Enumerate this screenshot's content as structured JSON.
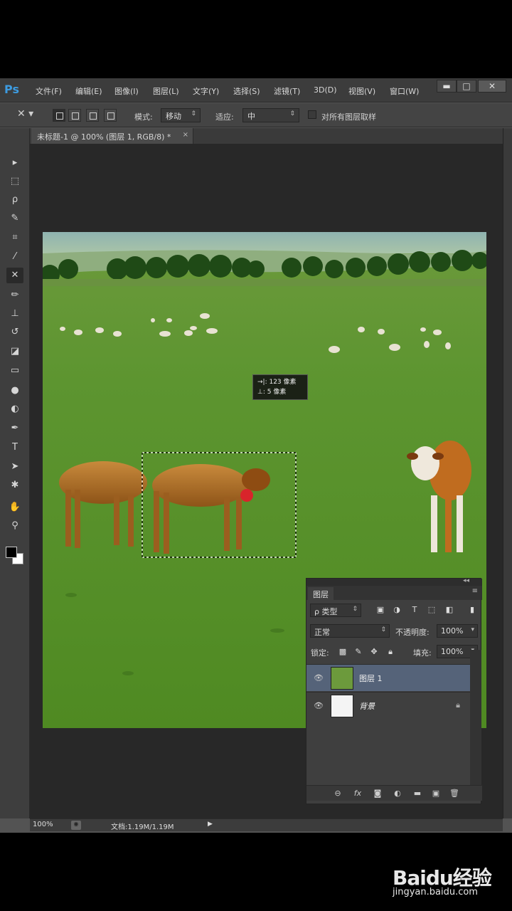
{
  "app": {
    "logo": "Ps"
  },
  "menu": [
    {
      "label": "文件(F)"
    },
    {
      "label": "编辑(E)"
    },
    {
      "label": "图像(I)"
    },
    {
      "label": "图层(L)"
    },
    {
      "label": "文字(Y)"
    },
    {
      "label": "选择(S)"
    },
    {
      "label": "滤镜(T)"
    },
    {
      "label": "3D(D)"
    },
    {
      "label": "视图(V)"
    },
    {
      "label": "窗口(W)"
    }
  ],
  "window_controls": {
    "minimize": "▬",
    "maximize": "□",
    "close": "✕"
  },
  "options_bar": {
    "mode_label": "模式:",
    "mode_value": "移动",
    "adapt_label": "适应:",
    "adapt_value": "中",
    "sample_all_label": "对所有图层取样",
    "sample_all_checked": false
  },
  "document_tab": {
    "title": "未标题-1 @ 100% (图层 1, RGB/8) *",
    "close": "×"
  },
  "tools": [
    {
      "name": "move-tool-icon",
      "glyph": "▸"
    },
    {
      "name": "marquee-tool-icon",
      "glyph": "⬚"
    },
    {
      "name": "lasso-tool-icon",
      "glyph": "ρ"
    },
    {
      "name": "quick-select-tool-icon",
      "glyph": "✎"
    },
    {
      "name": "crop-tool-icon",
      "glyph": "⌗"
    },
    {
      "name": "eyedropper-tool-icon",
      "glyph": "⁄"
    },
    {
      "name": "content-aware-move-tool-icon",
      "glyph": "✕",
      "active": true
    },
    {
      "name": "brush-tool-icon",
      "glyph": "✏"
    },
    {
      "name": "stamp-tool-icon",
      "glyph": "⊥"
    },
    {
      "name": "history-brush-tool-icon",
      "glyph": "↺"
    },
    {
      "name": "eraser-tool-icon",
      "glyph": "◪"
    },
    {
      "name": "gradient-tool-icon",
      "glyph": "▭"
    },
    {
      "name": "blur-tool-icon",
      "glyph": "●"
    },
    {
      "name": "dodge-tool-icon",
      "glyph": "◐"
    },
    {
      "name": "pen-tool-icon",
      "glyph": "✒"
    },
    {
      "name": "type-tool-icon",
      "glyph": "T"
    },
    {
      "name": "path-select-tool-icon",
      "glyph": "➤"
    },
    {
      "name": "shape-tool-icon",
      "glyph": "✱"
    },
    {
      "name": "hand-tool-icon",
      "glyph": "✋"
    },
    {
      "name": "zoom-tool-icon",
      "glyph": "⚲"
    }
  ],
  "colors": {
    "foreground": "#000000",
    "background": "#ffffff",
    "selected_layer": "#556379"
  },
  "tooltip": {
    "row1": "→|: 123 像素",
    "row2": "⊥:   5 像素"
  },
  "status": {
    "zoom": "100%",
    "doc": "文档:1.19M/1.19M"
  },
  "layers_panel": {
    "tab": "图层",
    "filter_label": "ρ 类型",
    "blend_mode": "正常",
    "opacity_label": "不透明度:",
    "opacity": "100%",
    "lock_label": "锁定:",
    "fill_label": "填充:",
    "fill": "100%",
    "layers": [
      {
        "name": "图层 1",
        "selected": true
      },
      {
        "name": "背景",
        "selected": false,
        "locked": true
      }
    ]
  },
  "watermark": {
    "logo": "Baidu经验",
    "url": "jingyan.baidu.com"
  }
}
